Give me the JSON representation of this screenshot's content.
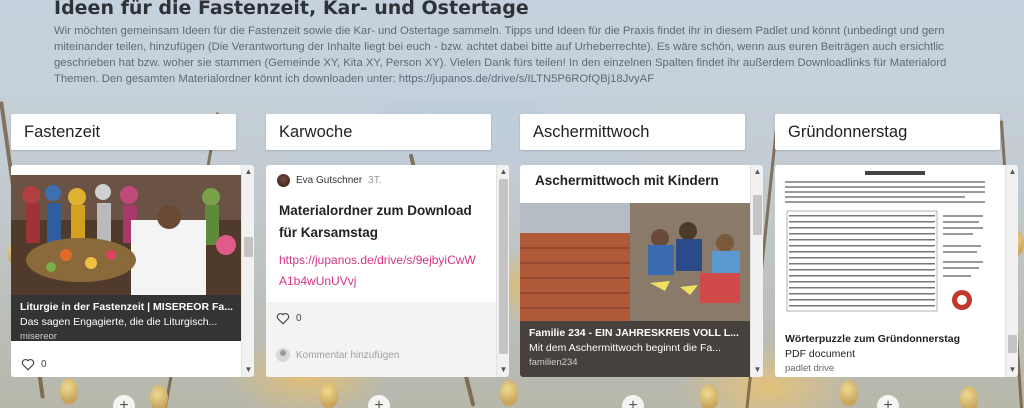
{
  "board": {
    "title": "Ideen für die Fastenzeit, Kar- und Ostertage",
    "description": "Wir möchten gemeinsam Ideen für die Fastenzeit sowie die Kar- und Ostertage sammeln. Tipps und Ideen für die Praxis findet ihr in diesem Padlet und könnt (unbedingt und gern\nmiteinander teilen, hinzufügen (Die Verantwortung der Inhalte liegt bei euch - bzw. achtet dabei bitte auf Urheberrechte). Es wäre schön, wenn aus euren Beiträgen auch ersichtlic\ngeschrieben hat bzw. woher sie stammen (Gemeinde XY, Kita XY, Person XY). Vielen Dank fürs teilen! In den einzelnen Spalten findet ihr außerdem Downloadlinks für Materialord\nThemen. Den gesamten Materialordner könnt ich downloaden unter: https://jupanos.de/drive/s/ILTN5P6ROfQBj18JvyAF"
  },
  "columns": [
    {
      "header": "Fastenzeit",
      "card": {
        "title": "Liturgie in der Fastenzeit | MISEREOR Fa...",
        "subtitle": "Das sagen Engagierte, die die Liturgisch...",
        "source": "misereor",
        "likes": "0"
      }
    },
    {
      "header": "Karwoche",
      "card": {
        "author": "Eva Gutschner",
        "time": "3T.",
        "title": "Materialordner zum Download für Karsamstag",
        "link": "https://jupanos.de/drive/s/9ejbyiCwWA1b4wUnUVvj",
        "likes": "0",
        "comment_placeholder": "Kommentar hinzufügen"
      }
    },
    {
      "header": "Aschermittwoch",
      "card": {
        "heading": "Aschermittwoch mit Kindern",
        "title": "Familie 234 - EIN JAHRESKREIS VOLL L...",
        "subtitle": "Mit dem Aschermittwoch beginnt die Fa...",
        "source": "familien234"
      }
    },
    {
      "header": "Gründonnerstag",
      "card": {
        "title": "Wörterpuzzle zum Gründonnerstag",
        "type": "PDF document",
        "source": "padlet drive"
      }
    }
  ],
  "add_label": "+",
  "colors": {
    "link": "#d63384",
    "header_bg": "#c4d1dc"
  }
}
